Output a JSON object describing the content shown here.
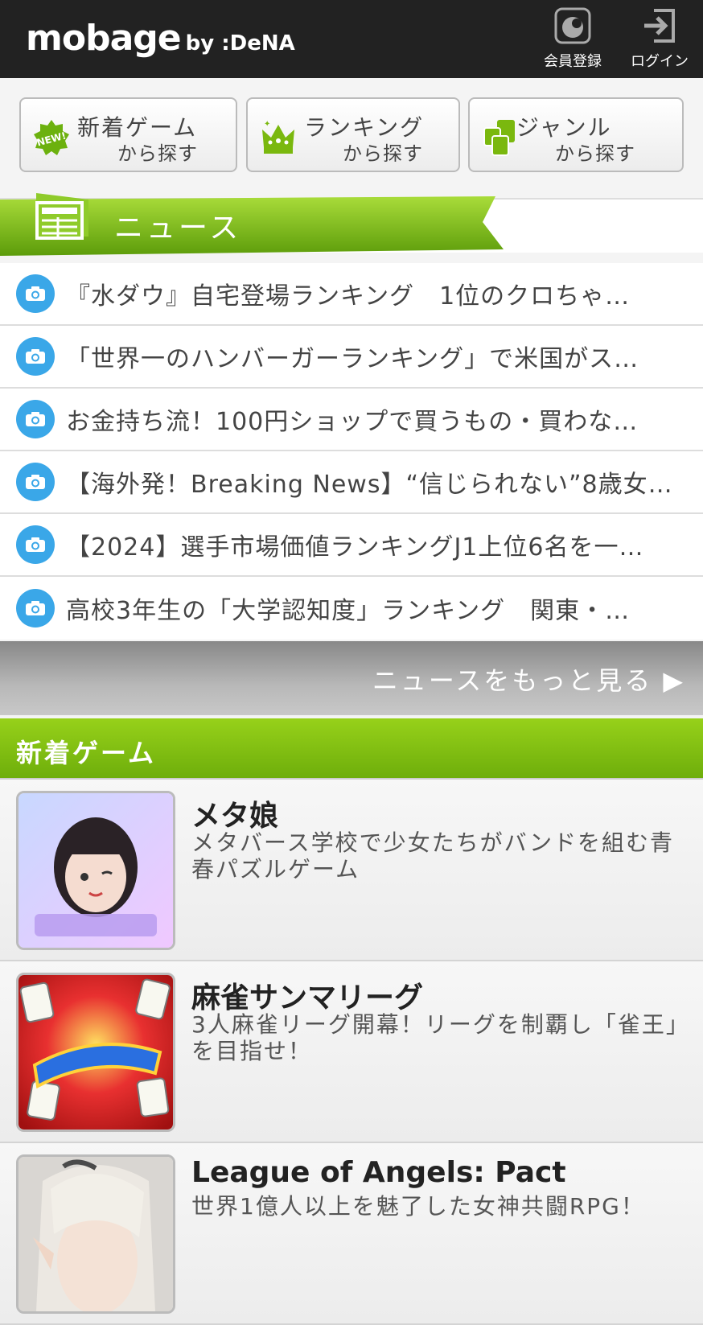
{
  "header": {
    "logo_main": "mobage",
    "logo_by": "by :DeNA",
    "register_label": "会員登録",
    "login_label": "ログイン"
  },
  "categories": [
    {
      "line1": "新着ゲーム",
      "line2": "から探す",
      "icon": "new-badge-icon"
    },
    {
      "line1": "ランキング",
      "line2": "から探す",
      "icon": "crown-icon"
    },
    {
      "line1": "ジャンル",
      "line2": "から探す",
      "icon": "genre-cards-icon"
    }
  ],
  "news": {
    "title": "ニュース",
    "items": [
      "『水ダウ』自宅登場ランキング　1位のクロちゃ…",
      "「世界一のハンバーガーランキング」で米国がス…",
      "お金持ち流！100円ショップで買うもの・買わな…",
      "【海外発！Breaking News】“信じられない”8歳女…",
      "【2024】選手市場価値ランキングJ1上位6名を一…",
      "高校3年生の「大学認知度」ランキング　関東・…"
    ],
    "more_label": "ニュースをもっと見る ▶"
  },
  "new_games": {
    "title": "新着ゲーム",
    "items": [
      {
        "name": "メタ娘",
        "desc": "メタバース学校で少女たちがバンドを組む青春パズルゲーム"
      },
      {
        "name": "麻雀サンマリーグ",
        "desc": "3人麻雀リーグ開幕！リーグを制覇し「雀王」を目指せ！"
      },
      {
        "name": "League of Angels: Pact",
        "desc": "世界1億人以上を魅了した女神共闘RPG！"
      }
    ]
  },
  "colors": {
    "header_bg": "#222222",
    "accent_green": "#7ab80e",
    "camera_blue": "#3aa7e8"
  }
}
